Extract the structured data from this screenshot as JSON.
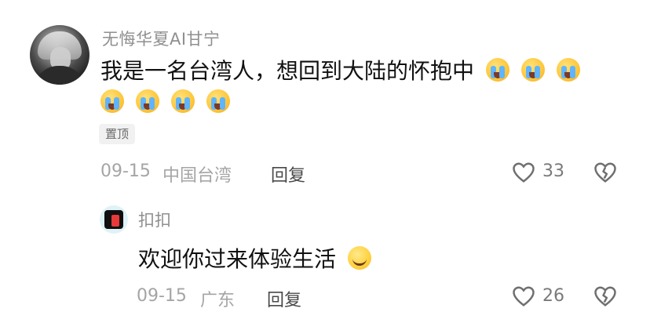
{
  "comment": {
    "username": "无悔华夏AI甘宁",
    "text": "我是一名台湾人，想回到大陆的怀抱中",
    "emojis_inline_count": 3,
    "emojis_next_line_count": 4,
    "pin_label": "置顶",
    "date": "09-15",
    "location": "中国台湾",
    "reply_label": "回复",
    "like_count": "33",
    "icons": {
      "like": "heart-outline-icon",
      "dislike": "broken-heart-icon",
      "emoji": "loudly-crying-face-emoji"
    }
  },
  "reply": {
    "username": "扣扣",
    "text": "欢迎你过来体验生活",
    "date": "09-15",
    "location": "广东",
    "reply_label": "回复",
    "like_count": "26",
    "icons": {
      "like": "heart-outline-icon",
      "dislike": "broken-heart-icon",
      "emoji": "smiling-face-emoji"
    }
  },
  "colors": {
    "primary_text": "#111111",
    "secondary_text": "#8f8f8f",
    "meta_text": "#a5a5a5",
    "action_text": "#4a4a4a",
    "badge_bg": "#f1f1f1"
  }
}
